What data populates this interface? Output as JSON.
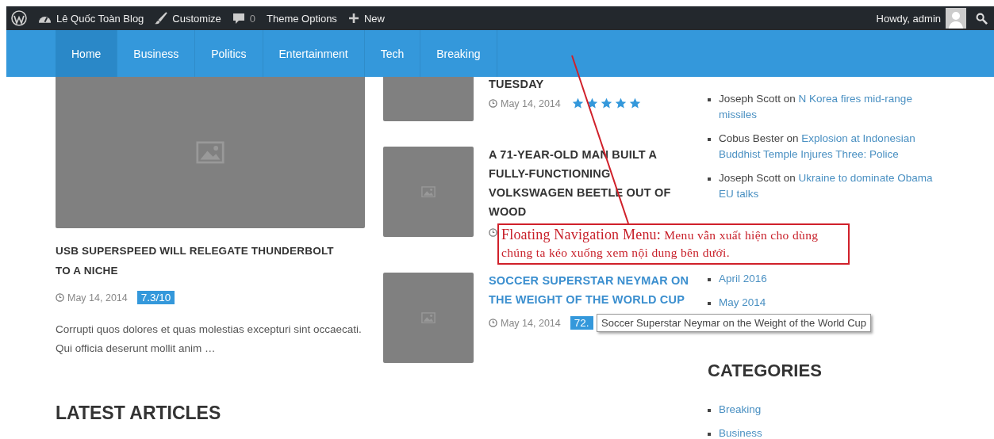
{
  "admin_bar": {
    "items": [
      {
        "kind": "logo"
      },
      {
        "kind": "site",
        "label": "Lê Quốc Toàn Blog"
      },
      {
        "kind": "customize",
        "label": "Customize"
      },
      {
        "kind": "comments",
        "label": "0"
      },
      {
        "kind": "text",
        "label": "Theme Options"
      },
      {
        "kind": "new",
        "label": "New"
      }
    ],
    "greeting": "Howdy, admin"
  },
  "nav": {
    "items": [
      {
        "label": "Home",
        "selected": true
      },
      {
        "label": "Business",
        "selected": false
      },
      {
        "label": "Politics",
        "selected": false
      },
      {
        "label": "Entertainment",
        "selected": false
      },
      {
        "label": "Tech",
        "selected": false
      },
      {
        "label": "Breaking",
        "selected": false
      }
    ]
  },
  "featured": {
    "title": "USB SUPERSPEED WILL RELEGATE THUNDERBOLT TO A NICHE",
    "date": "May 14, 2014",
    "score": "7.3/10",
    "excerpt": "Corrupti quos dolores et quas molestias excepturi sint occaecati. Qui officia deserunt mollit anim …"
  },
  "latest_heading": "LATEST ARTICLES",
  "posts": [
    {
      "kind": "stars",
      "title": "TUESDAY",
      "hovered": false,
      "date": "May 14, 2014",
      "stars": 5
    },
    {
      "kind": "covered",
      "title": "A 71-YEAR-OLD MAN BUILT A FULLY-FUNCTIONING VOLKSWAGEN BEETLE OUT OF WOOD",
      "hovered": false
    },
    {
      "kind": "score",
      "title": "SOCCER SUPERSTAR NEYMAR ON THE WEIGHT OF THE WORLD CUP",
      "hovered": true,
      "date": "May 14, 2014",
      "score": "72."
    }
  ],
  "recent_comments": [
    {
      "author": "Joseph Scott",
      "on": "on",
      "post": "N Korea fires mid-range missiles"
    },
    {
      "author": "Cobus Bester",
      "on": "on",
      "post": "Explosion at Indonesian Buddhist Temple Injures Three: Police"
    },
    {
      "author": "Joseph Scott",
      "on": "on",
      "post": "Ukraine to dominate Obama EU talks"
    }
  ],
  "archives": [
    "April 2016",
    "May 2014"
  ],
  "categories": {
    "heading": "CATEGORIES",
    "items": [
      "Breaking",
      "Business"
    ]
  },
  "annotation": {
    "title": "Floating Navigation Menu:",
    "text": "Menu vẫn xuất hiện cho dùng chúng ta kéo xuống xem nội dung bên dưới."
  },
  "tooltip": "Soccer Superstar Neymar on the Weight of the World Cup"
}
